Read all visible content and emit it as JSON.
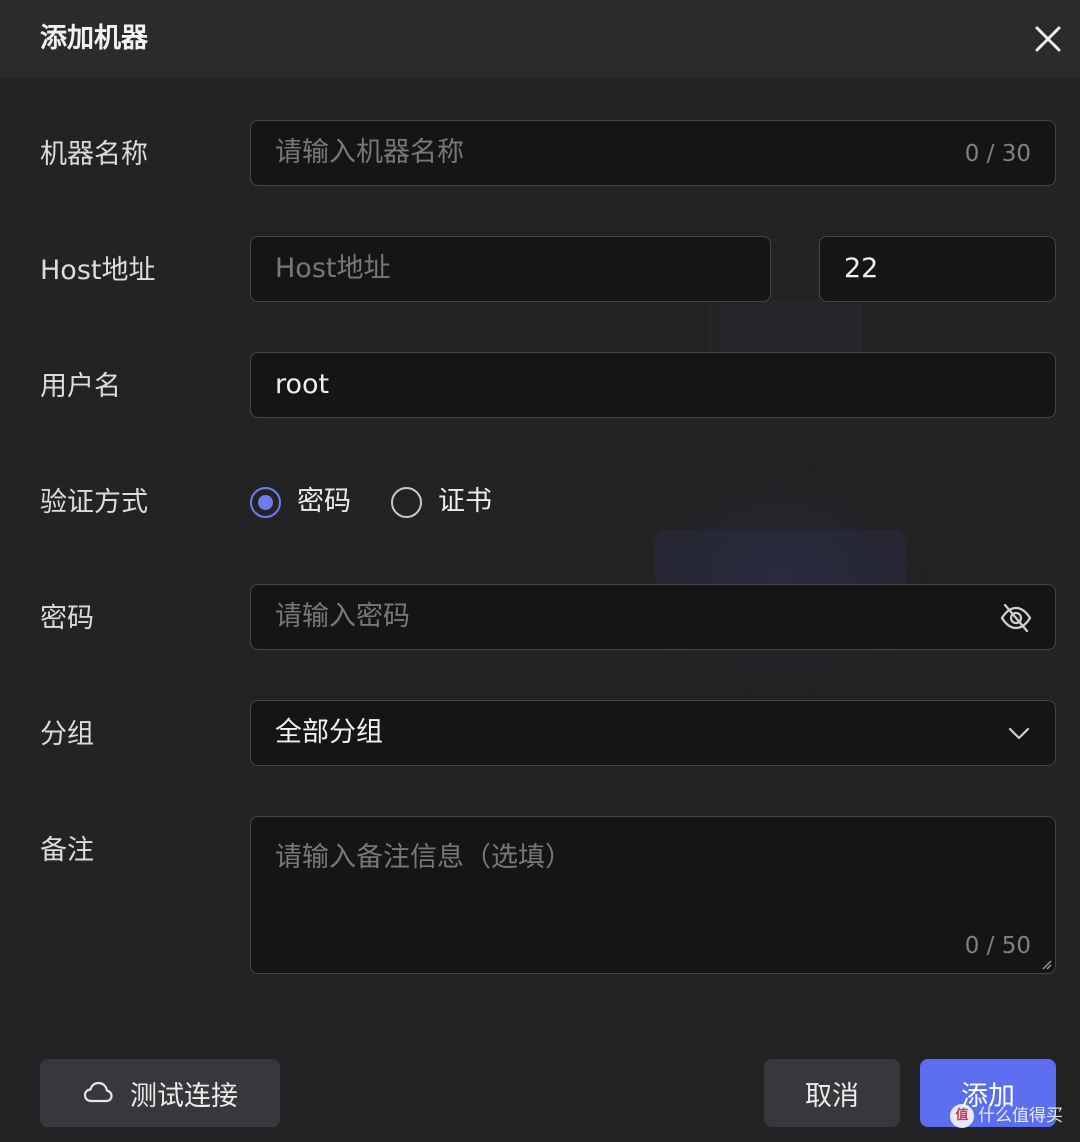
{
  "dialog": {
    "title": "添加机器",
    "close_icon": "close-icon"
  },
  "form": {
    "name": {
      "label": "机器名称",
      "placeholder": "请输入机器名称",
      "value": "",
      "counter": "0 / 30"
    },
    "host": {
      "label": "Host地址",
      "placeholder": "Host地址",
      "value": "",
      "port": "22"
    },
    "username": {
      "label": "用户名",
      "value": "root"
    },
    "auth": {
      "label": "验证方式",
      "options": [
        {
          "label": "密码",
          "checked": true
        },
        {
          "label": "证书",
          "checked": false
        }
      ]
    },
    "password": {
      "label": "密码",
      "placeholder": "请输入密码",
      "value": "",
      "toggle_icon": "eye-off-icon"
    },
    "group": {
      "label": "分组",
      "selected": "全部分组",
      "dropdown_icon": "chevron-down-icon"
    },
    "note": {
      "label": "备注",
      "placeholder": "请输入备注信息（选填）",
      "value": "",
      "counter": "0 / 50"
    }
  },
  "footer": {
    "test_label": "测试连接",
    "test_icon": "cloud-icon",
    "cancel_label": "取消",
    "add_label": "添加"
  },
  "colors": {
    "background": "#232325",
    "header": "#2b2b2e",
    "input_bg": "#151516",
    "border": "#45454a",
    "accent": "#5c6ef0",
    "radio_accent": "#6d7df0"
  },
  "watermark": {
    "text": "值 什么值得买",
    "icon": "zhi-icon"
  }
}
